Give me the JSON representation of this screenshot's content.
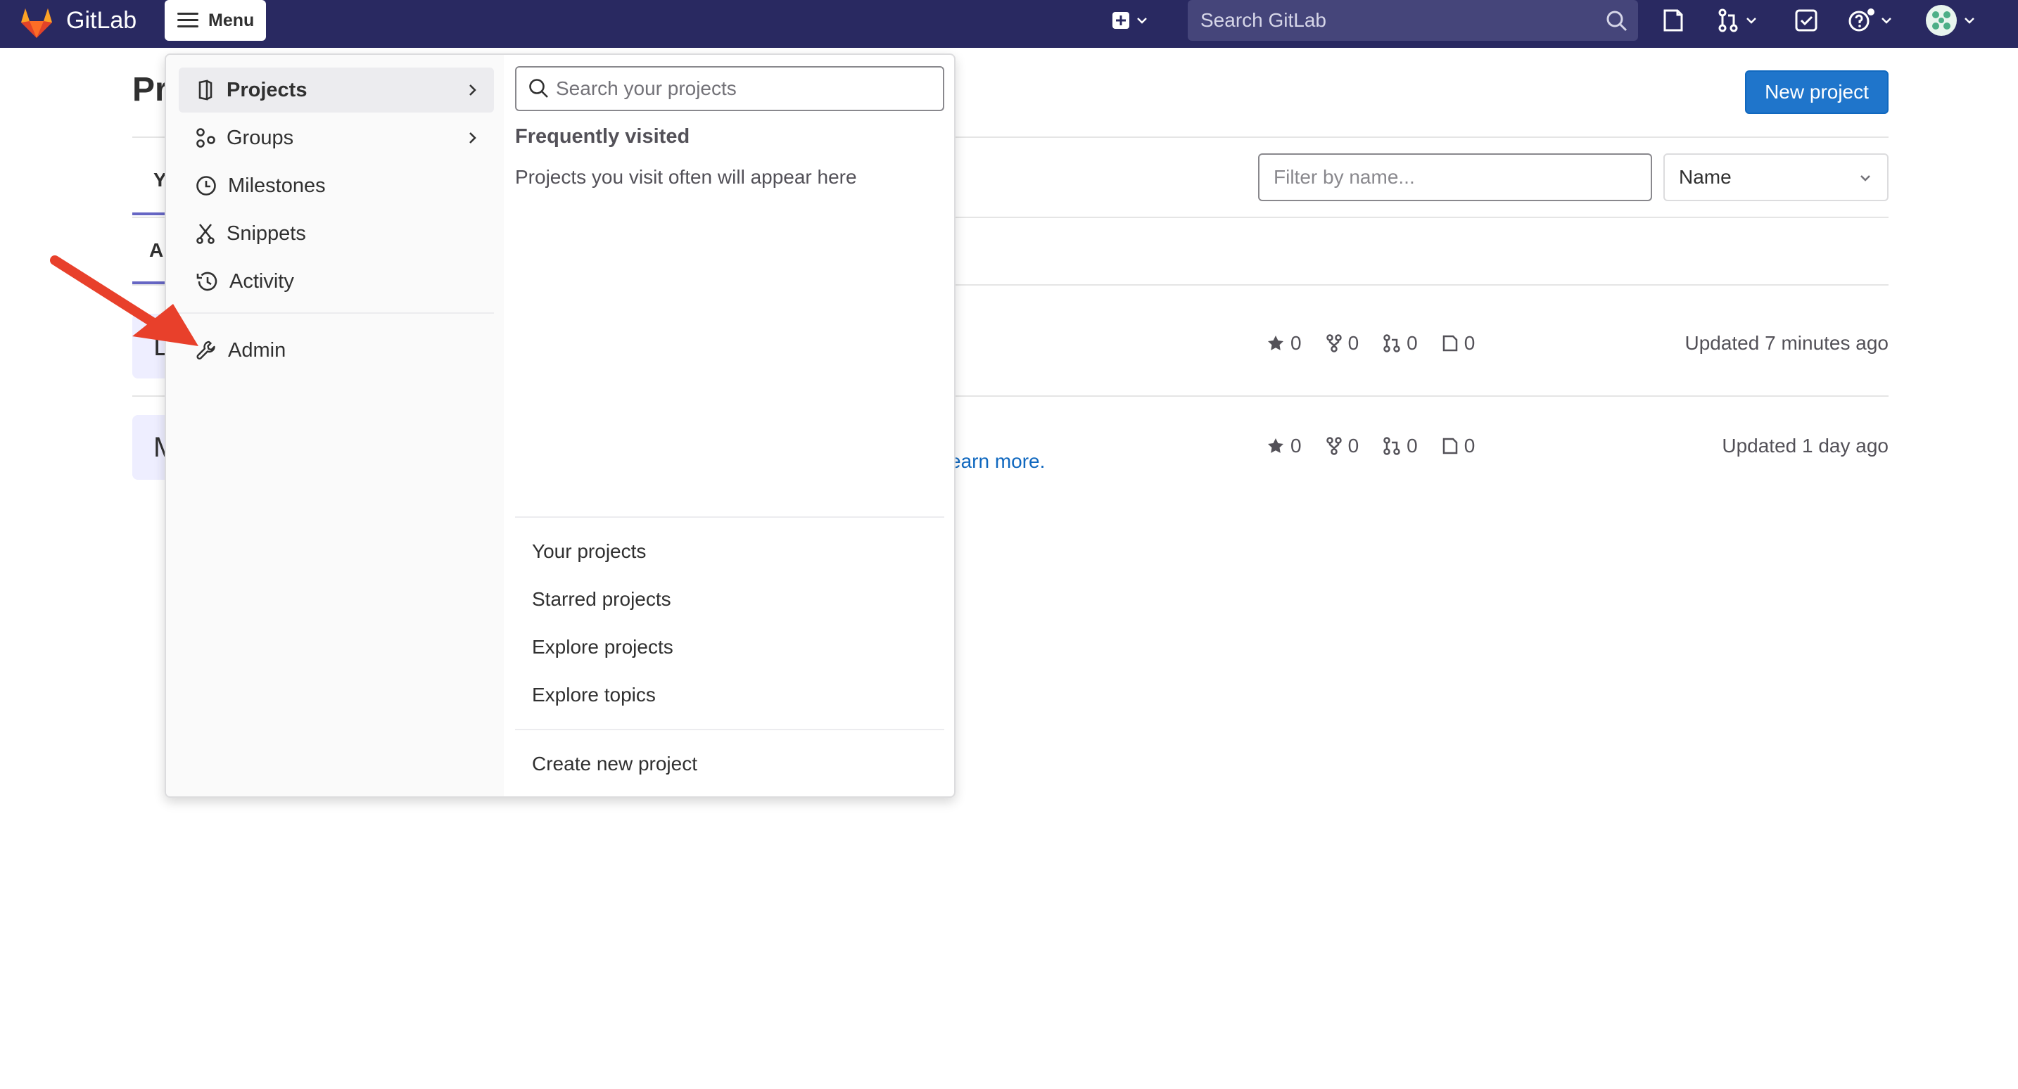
{
  "colors": {
    "topbar": "#292961",
    "primary_button": "#1f75cb",
    "link": "#1068bf",
    "annotation_arrow": "#e8402b"
  },
  "topbar": {
    "brand": "GitLab",
    "menu_label": "Menu",
    "search_placeholder": "Search GitLab"
  },
  "page": {
    "title_peek": "Pr",
    "new_project_label": "New project",
    "filter_placeholder": "Filter by name...",
    "sort_value": "Name",
    "tab_peek_1": "Y",
    "tab_peek_2": "A",
    "learn_more_peek": "earn more.",
    "rows": [
      {
        "avatar_peek": "L",
        "stars": "0",
        "forks": "0",
        "merge_requests": "0",
        "issues": "0",
        "updated": "Updated 7 minutes ago"
      },
      {
        "avatar_peek": "M",
        "stars": "0",
        "forks": "0",
        "merge_requests": "0",
        "issues": "0",
        "updated": "Updated 1 day ago"
      }
    ]
  },
  "menu": {
    "items": [
      {
        "label": "Projects",
        "icon": "project-icon",
        "active": true,
        "has_submenu": true
      },
      {
        "label": "Groups",
        "icon": "group-icon",
        "active": false,
        "has_submenu": true
      },
      {
        "label": "Milestones",
        "icon": "clock-icon",
        "active": false,
        "has_submenu": false
      },
      {
        "label": "Snippets",
        "icon": "snippet-icon",
        "active": false,
        "has_submenu": false
      },
      {
        "label": "Activity",
        "icon": "history-icon",
        "active": false,
        "has_submenu": false
      },
      {
        "label": "Admin",
        "icon": "wrench-icon",
        "active": false,
        "has_submenu": false
      }
    ],
    "projects_panel": {
      "search_placeholder": "Search your projects",
      "frequently_title": "Frequently visited",
      "frequently_empty": "Projects you visit often will appear here",
      "links": [
        "Your projects",
        "Starred projects",
        "Explore projects",
        "Explore topics"
      ],
      "create_link": "Create new project"
    }
  }
}
